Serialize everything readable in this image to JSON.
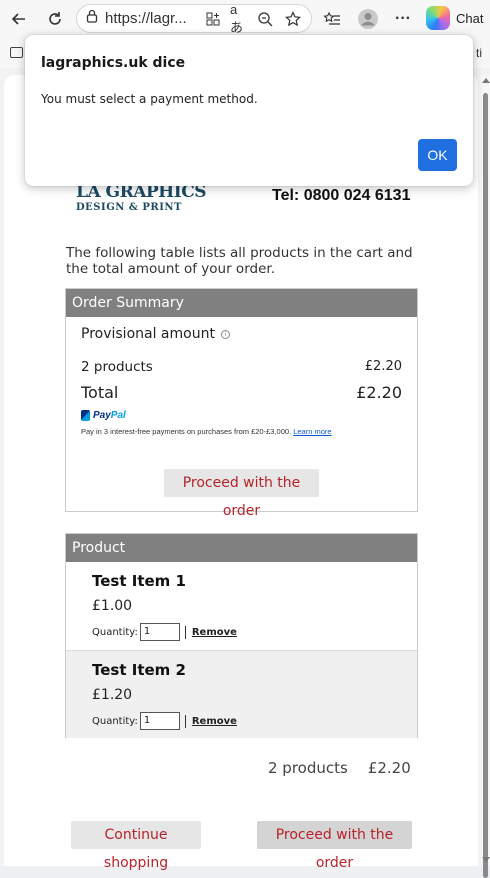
{
  "browser": {
    "url": "https://lagr...",
    "chat_label": "Chat",
    "fav_overflow": "ti"
  },
  "site": {
    "logo_main": "LA GRAPHICS",
    "logo_sub": "DESIGN & PRINT",
    "tel": "Tel: 0800 024 6131",
    "intro": "The following table lists all products in the cart and the total amount of your order."
  },
  "summary": {
    "header": "Order Summary",
    "provisional_label": "Provisional amount",
    "products_label": "2 products",
    "products_value": "£2.20",
    "total_label": "Total",
    "total_value": "£2.20",
    "paypal_pay": "Pay",
    "paypal_pal": "Pal",
    "paypal_text": "Pay in 3 interest-free payments on purchases from £20-£3,000.",
    "paypal_link": "Learn more",
    "proceed_label": "Proceed with the order"
  },
  "products": {
    "header": "Product",
    "qty_label": "Quantity:",
    "remove_label": "Remove",
    "items": [
      {
        "name": "Test Item 1",
        "price": "£1.00",
        "qty": "1"
      },
      {
        "name": "Test Item 2",
        "price": "£1.20",
        "qty": "1"
      }
    ]
  },
  "footer": {
    "count": "2 products",
    "amount": "£2.20",
    "continue_label": "Continue shopping",
    "proceed_label": "Proceed with the order"
  },
  "dialog": {
    "title": "lagraphics.uk dice",
    "message": "You must select a payment method.",
    "ok_label": "OK"
  }
}
